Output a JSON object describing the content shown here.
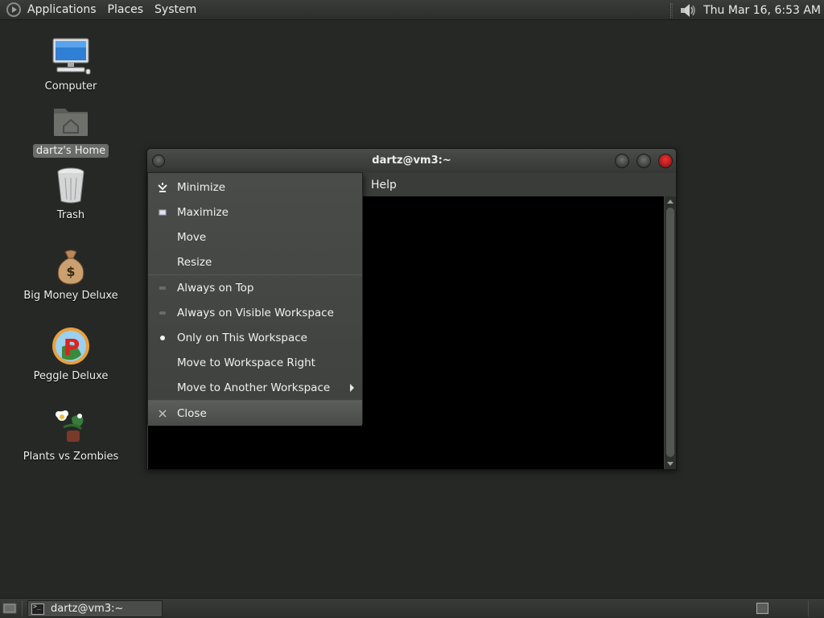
{
  "top_panel": {
    "menus": [
      "Applications",
      "Places",
      "System"
    ],
    "clock": "Thu Mar 16,  6:53 AM"
  },
  "desktop": {
    "icons": [
      {
        "label": "Computer",
        "icon": "computer-icon"
      },
      {
        "label": "dartz's Home",
        "icon": "home-folder-icon",
        "selected": true
      },
      {
        "label": "Trash",
        "icon": "trash-icon"
      },
      {
        "label": "Big Money Deluxe",
        "icon": "money-bag-icon"
      },
      {
        "label": "Peggle Deluxe",
        "icon": "peggle-icon"
      },
      {
        "label": "Plants vs Zombies",
        "icon": "plants-vs-zombies-icon"
      }
    ]
  },
  "terminal_window": {
    "title": "dartz@vm3:~",
    "menu_help": "Help"
  },
  "window_menu": {
    "items": [
      {
        "label": "Minimize",
        "mark": "minimize"
      },
      {
        "label": "Maximize",
        "mark": "maximize"
      },
      {
        "label": "Move",
        "mark": ""
      },
      {
        "label": "Resize",
        "mark": ""
      },
      {
        "label": "Always on Top",
        "mark": "checkbox-off"
      },
      {
        "label": "Always on Visible Workspace",
        "mark": "radio-off"
      },
      {
        "label": "Only on This Workspace",
        "mark": "radio-on"
      },
      {
        "label": "Move to Workspace Right",
        "mark": ""
      },
      {
        "label": "Move to Another Workspace",
        "mark": "",
        "submenu": true
      },
      {
        "label": "Close",
        "mark": "close",
        "highlighted": true
      }
    ]
  },
  "bottom_panel": {
    "task_label": "dartz@vm3:~"
  },
  "colors": {
    "desktop_bg": "#262826",
    "panel_bg": "#333533",
    "menu_bg": "#454745",
    "close_button": "#e02020"
  }
}
